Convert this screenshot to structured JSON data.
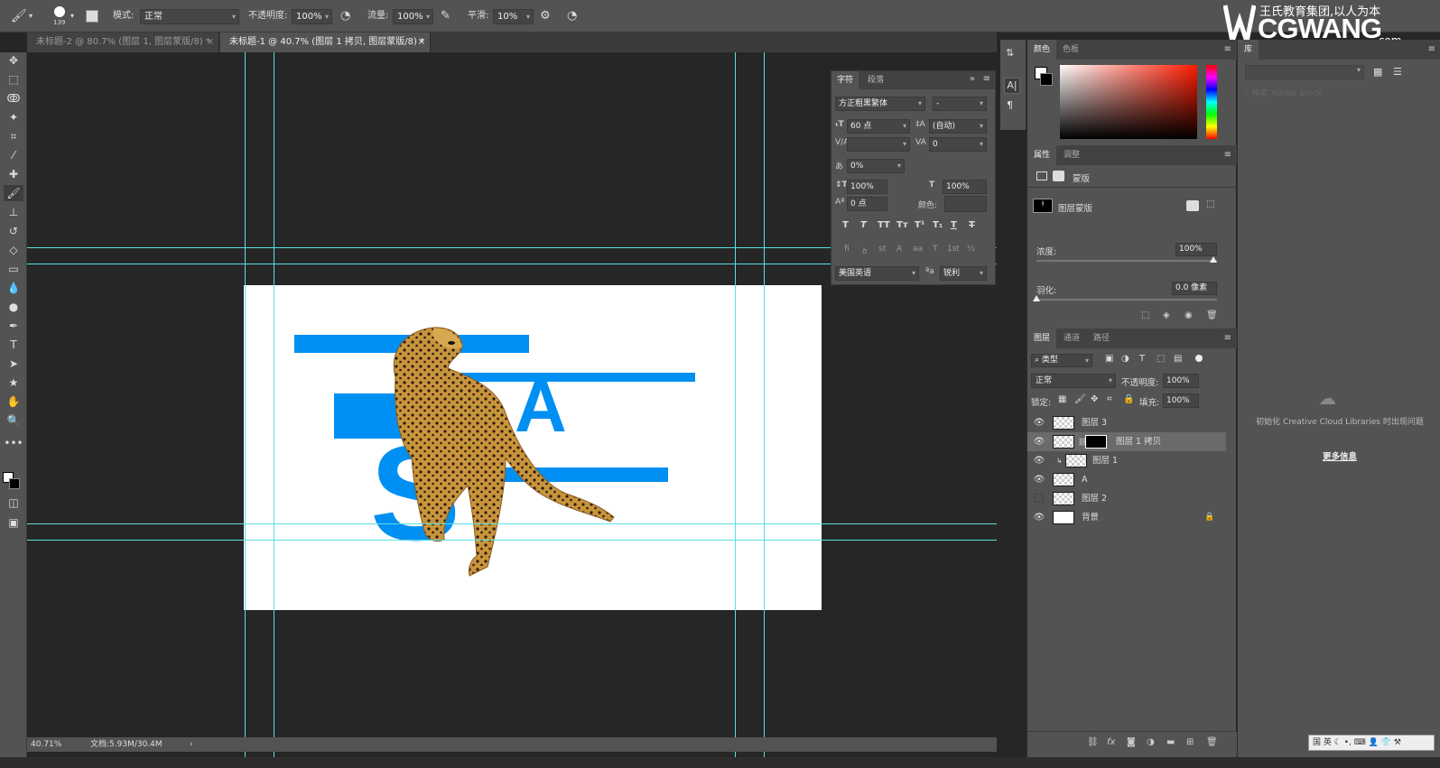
{
  "options_bar": {
    "brush_size": "139",
    "mode_label": "模式:",
    "mode_value": "正常",
    "opacity_label": "不透明度:",
    "opacity_value": "100%",
    "flow_label": "流量:",
    "flow_value": "100%",
    "smoothing_label": "平滑:",
    "smoothing_value": "10%"
  },
  "logo": {
    "slogan": "王氏教育集团,以人为本",
    "brand": "CGWANG",
    "domain": ".com"
  },
  "tabs": [
    {
      "label": "未标题-2 @ 80.7% (图层 1, 图层蒙版/8) *",
      "active": false
    },
    {
      "label": "未标题-1 @ 40.7% (图层 1 拷贝, 图层蒙版/8) *",
      "active": true
    }
  ],
  "tab_close": "×",
  "canvas": {
    "letter_a": "A",
    "letter_s": "S"
  },
  "character_panel": {
    "tabs": [
      "字符",
      "段落"
    ],
    "font_family": "方正粗黑繁体",
    "font_style": "-",
    "font_size": "60 点",
    "leading": "(自动)",
    "kerning": "",
    "tracking": "0",
    "tsume": "0%",
    "vertical_scale": "100%",
    "horizontal_scale": "100%",
    "baseline_shift": "0 点",
    "color_label": "颜色:",
    "style_buttons": [
      "T",
      "T",
      "TT",
      "Tт",
      "T¹",
      "T₁",
      "T",
      "T"
    ],
    "opentype_buttons": [
      "fi",
      "ꝺ",
      "st",
      "A",
      "aa",
      "T",
      "1st",
      "½"
    ],
    "language": "美国英语",
    "aa_label": "a",
    "antialias": "锐利"
  },
  "color_panel": {
    "tabs": [
      "颜色",
      "色板"
    ]
  },
  "properties_panel": {
    "tabs": [
      "属性",
      "调整"
    ],
    "type_label": "蒙版",
    "mask_label": "图层蒙版",
    "density_label": "浓度:",
    "density_value": "100%",
    "feather_label": "羽化:",
    "feather_value": "0.0 像素"
  },
  "layers_panel": {
    "tabs": [
      "图层",
      "通道",
      "路径"
    ],
    "filter_kind": "类型",
    "blend_mode": "正常",
    "opacity_label": "不透明度:",
    "opacity_value": "100%",
    "lock_label": "锁定:",
    "fill_label": "填充:",
    "fill_value": "100%",
    "layers": [
      {
        "name": "图层 3",
        "visible": true,
        "selected": false
      },
      {
        "name": "图层 1 拷贝",
        "visible": true,
        "selected": true
      },
      {
        "name": "图层 1",
        "visible": true,
        "selected": false
      },
      {
        "name": "A",
        "visible": true,
        "selected": false
      },
      {
        "name": "图层 2",
        "visible": false,
        "selected": false
      },
      {
        "name": "背景",
        "visible": true,
        "selected": false
      }
    ]
  },
  "libraries_panel": {
    "tab": "库",
    "search_placeholder": "搜索 Adobe Stock",
    "init_message": "初始化 Creative Cloud Libraries 时出现问题",
    "more_info": "更多信息"
  },
  "status_bar": {
    "zoom": "40.71%",
    "doc_size": "文档:5.93M/30.4M"
  },
  "ime": {
    "lang": "英"
  }
}
